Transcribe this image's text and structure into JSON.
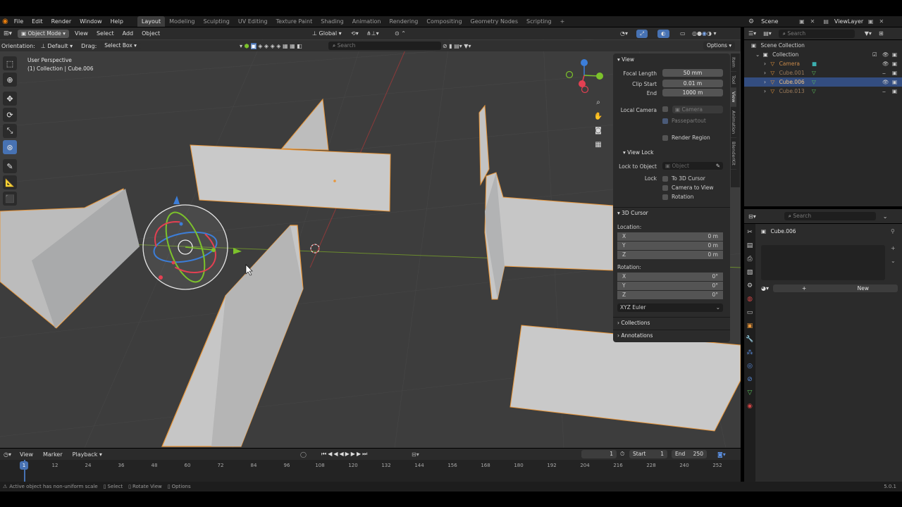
{
  "menu": {
    "items": [
      "File",
      "Edit",
      "Render",
      "Window",
      "Help"
    ],
    "workspaces": [
      "Layout",
      "Modeling",
      "Sculpting",
      "UV Editing",
      "Texture Paint",
      "Shading",
      "Animation",
      "Rendering",
      "Compositing",
      "Geometry Nodes",
      "Scripting"
    ],
    "active_workspace": "Layout",
    "add_tab": "+",
    "scene": "Scene",
    "view_layer": "ViewLayer"
  },
  "viewport_header": {
    "mode": "Object Mode",
    "menus": [
      "View",
      "Select",
      "Add",
      "Object"
    ],
    "transform_orientation": "Global",
    "orientation_label": "Orientation:",
    "orientation_value": "Default",
    "drag_label": "Drag:",
    "drag_value": "Select Box",
    "search_placeholder": "Search",
    "options": "Options"
  },
  "viewport": {
    "perspective": "User Perspective",
    "context": "(1) Collection | Cube.006"
  },
  "npanel": {
    "tabs": [
      "Item",
      "Tool",
      "View",
      "Animation",
      "BlenderKit"
    ],
    "view_header": "View",
    "focal_length_label": "Focal Length",
    "focal_length": "50 mm",
    "clip_start_label": "Clip Start",
    "clip_start": "0.01 m",
    "end_label": "End",
    "end": "1000 m",
    "local_camera_label": "Local Camera",
    "local_camera": "Camera",
    "passepartout": "Passepartout",
    "render_region": "Render Region",
    "view_lock": "View Lock",
    "lock_to_object_label": "Lock to Object",
    "lock_to_object": "Object",
    "lock_label": "Lock",
    "to_3d_cursor": "To 3D Cursor",
    "camera_to_view": "Camera to View",
    "rotation_check": "Rotation",
    "cursor_header": "3D Cursor",
    "location_label": "Location:",
    "location": [
      {
        "axis": "X",
        "value": "0 m"
      },
      {
        "axis": "Y",
        "value": "0 m"
      },
      {
        "axis": "Z",
        "value": "0 m"
      }
    ],
    "rotation_label": "Rotation:",
    "rotation": [
      {
        "axis": "X",
        "value": "0°"
      },
      {
        "axis": "Y",
        "value": "0°"
      },
      {
        "axis": "Z",
        "value": "0°"
      }
    ],
    "rotation_mode": "XYZ Euler",
    "collections": "Collections",
    "annotations": "Annotations"
  },
  "outliner": {
    "search_placeholder": "Search",
    "root": "Scene Collection",
    "collection": "Collection",
    "items": [
      {
        "name": "Camera",
        "selected": false
      },
      {
        "name": "Cube.001",
        "selected": false
      },
      {
        "name": "Cube.006",
        "selected": true
      },
      {
        "name": "Cube.013",
        "selected": false
      }
    ]
  },
  "properties": {
    "search_placeholder": "Search",
    "object_name": "Cube.006",
    "new_button": "New"
  },
  "timeline": {
    "menus": [
      "View",
      "Marker",
      "Playback"
    ],
    "current_frame": "1",
    "start_label": "Start",
    "start": "1",
    "end_label": "End",
    "end": "250",
    "ticks": [
      "1",
      "12",
      "24",
      "36",
      "48",
      "60",
      "72",
      "84",
      "96",
      "108",
      "120",
      "132",
      "144",
      "156",
      "168",
      "180",
      "192",
      "204",
      "216",
      "228",
      "240",
      "252"
    ]
  },
  "statusbar": {
    "warning": "Active object has non-uniform scale",
    "select": "Select",
    "rotate_view": "Rotate View",
    "options": "Options",
    "version": "5.0.1"
  },
  "colors": {
    "accent": "#4772b3",
    "selection_outline": "#e8963a",
    "x_axis": "#e34052",
    "y_axis": "#7cc22b",
    "z_axis": "#3c7ed9"
  }
}
